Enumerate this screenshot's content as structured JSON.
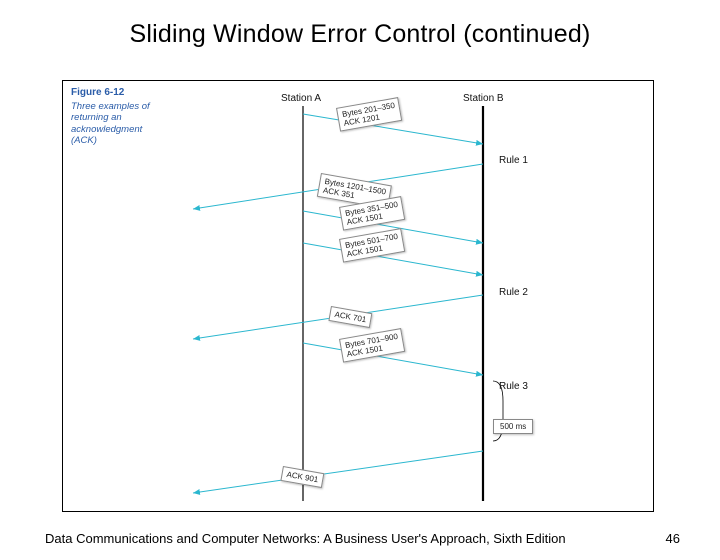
{
  "title": "Sliding Window Error Control (continued)",
  "footer": {
    "left": "Data Communications and Computer Networks: A Business User's Approach, Sixth Edition",
    "page": "46"
  },
  "figure": {
    "label": "Figure 6-12",
    "caption": "Three examples of returning an acknowledgment (ACK)",
    "stationA": "Station A",
    "stationB": "Station B",
    "rules": {
      "r1": "Rule 1",
      "r2": "Rule 2",
      "r3": "Rule 3"
    },
    "delay": "500 ms",
    "packets": {
      "p1": {
        "bytes": "Bytes 201–350",
        "ack": "ACK 1201"
      },
      "p2": {
        "bytes": "Bytes 1201–1500",
        "ack": "ACK 351"
      },
      "p3": {
        "bytes": "Bytes 351–500",
        "ack": "ACK 1501"
      },
      "p4": {
        "bytes": "Bytes 501–700",
        "ack": "ACK 1501"
      },
      "p5": {
        "ack": "ACK 701"
      },
      "p6": {
        "bytes": "Bytes 701–900",
        "ack": "ACK 1501"
      },
      "p7": {
        "ack": "ACK 901"
      }
    }
  }
}
